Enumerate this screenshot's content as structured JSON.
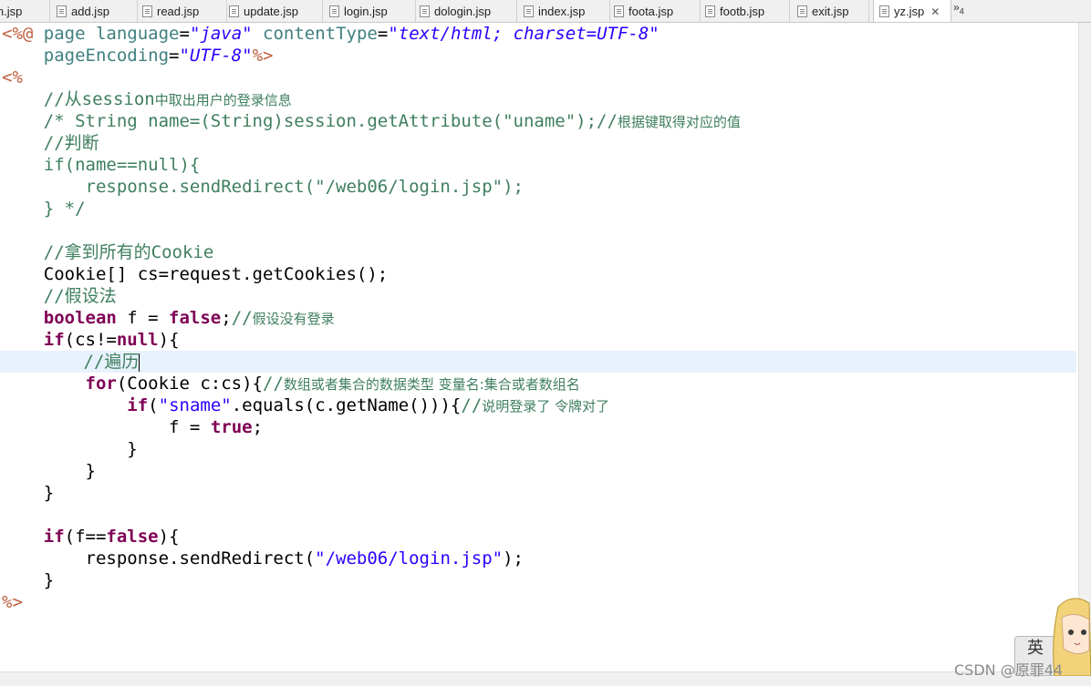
{
  "tabs": [
    {
      "label": "in.jsp"
    },
    {
      "label": "add.jsp"
    },
    {
      "label": "read.jsp"
    },
    {
      "label": "update.jsp"
    },
    {
      "label": "login.jsp"
    },
    {
      "label": "dologin.jsp"
    },
    {
      "label": "index.jsp"
    },
    {
      "label": "foota.jsp"
    },
    {
      "label": "footb.jsp"
    },
    {
      "label": "exit.jsp"
    },
    {
      "label": "yz.jsp",
      "active": true
    }
  ],
  "overflow": {
    "glyph": "»",
    "count": "4"
  },
  "code": {
    "l1": {
      "a": "<%@",
      "b": " page ",
      "c": "language",
      "d": "=",
      "e": "\"java\"",
      "f": " contentType",
      "g": "=",
      "h": "\"text/html; charset=UTF-8\""
    },
    "l2": {
      "a": "    pageEncoding",
      "b": "=",
      "c": "\"UTF-8\"",
      "d": "%>"
    },
    "l3": {
      "a": "<%"
    },
    "l4": {
      "a": "    //从session",
      "b": "中取出用户的登录信息"
    },
    "l5": {
      "a": "    /* String name=(String)session.getAttribute(\"uname\");//",
      "b": "根据键取得对应的值"
    },
    "l6": {
      "a": "    //判断"
    },
    "l7": {
      "a": "    if(name==null){"
    },
    "l8": {
      "a": "        response.sendRedirect(\"/web06/login.jsp\");"
    },
    "l9": {
      "a": "    } */"
    },
    "l11": {
      "a": "    //拿到所有的Cookie"
    },
    "l12": {
      "a": "    Cookie[] cs=request.getCookies();"
    },
    "l13": {
      "a": "    //假设法"
    },
    "l14": {
      "a": "boolean",
      "b": " f = ",
      "c": "false",
      "d": ";",
      "e": "//",
      "f": "假设没有登录"
    },
    "l15": {
      "a": "if",
      "b": "(cs!=",
      "c": "null",
      "d": "){"
    },
    "l16": {
      "a": "        //遍历"
    },
    "l17": {
      "a": "for",
      "b": "(Cookie c:cs){",
      "c": "//",
      "d": "数组或者集合的数据类型 变量名:集合或者数组名"
    },
    "l18": {
      "a": "if",
      "b": "(",
      "c": "\"sname\"",
      "d": ".equals(c.getName())){",
      "e": "//",
      "f": "说明登录了 令牌对了"
    },
    "l19": {
      "a": " = ",
      "b": "true",
      "c": ";",
      "v": "f"
    },
    "l20": {
      "a": "            }"
    },
    "l21": {
      "a": "        }"
    },
    "l22": {
      "a": "    }"
    },
    "l24": {
      "a": "if",
      "b": "(f==",
      "c": "false",
      "d": "){"
    },
    "l25": {
      "a": "        response.sendRedirect(",
      "b": "\"/web06/login.jsp\"",
      "c": ");"
    },
    "l26": {
      "a": "    }"
    },
    "l27": {
      "a": "%>"
    }
  },
  "ime": {
    "label": "英"
  },
  "watermark": {
    "text": "CSDN @原罪44"
  },
  "colors": {
    "keyword": "#7f0055",
    "string": "#2a00ff",
    "comment": "#3f7f5f",
    "directive": "#bf5f3f",
    "attribute": "#3f7f7f",
    "current_line": "#e8f2fe"
  }
}
